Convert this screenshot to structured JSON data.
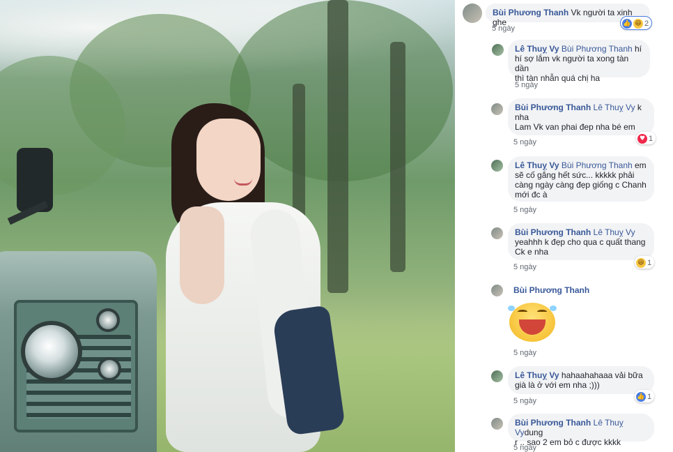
{
  "comments": [
    {
      "author": "Bùi Phương Thanh",
      "text": " Vk người ta xinh ghe",
      "time": "5 ngày",
      "reactions": {
        "icons": [
          "like-icon",
          "haha-icon"
        ],
        "count": "2"
      }
    },
    {
      "author": "Lê Thuỵ Vy",
      "mention": " Bùi Phương Thanh",
      "line1_rest": " hí",
      "line2": "hí sợ lắm vk người ta xong tàn dần",
      "line3": "thì tàn nhẫn quá chị ha",
      "time": "5 ngày"
    },
    {
      "author": "Bùi Phương Thanh",
      "mention": " Lê Thuỵ Vy",
      "line1_rest": " k",
      "line2": "nha",
      "line3": "Lam Vk van phai đep nha bé em",
      "time": "5 ngày",
      "reactions": {
        "icons": [
          "love-icon"
        ],
        "count": "1"
      }
    },
    {
      "author": "Lê Thuỵ Vy",
      "mention": " Bùi Phương Thanh",
      "line1_rest": " em",
      "line2": "sẽ cố gắng hết sức... kkkkk phải",
      "line3": "càng ngày càng đẹp giống c Chanh",
      "line4": "mới đc à",
      "time": "5 ngày"
    },
    {
      "author": "Bùi Phương Thanh",
      "mention": " Lê Thuỵ Vy",
      "line2": "yeahhh k đẹp cho qua c quất thang",
      "line3": "Ck e nha",
      "time": "5 ngày",
      "reactions": {
        "icons": [
          "haha-icon"
        ],
        "count": "1"
      }
    },
    {
      "author": "Bùi Phương Thanh",
      "sticker": "laughing-sticker",
      "time": "5 ngày"
    },
    {
      "author": "Lê Thuỵ Vy",
      "line1_rest": " hahaahahaaa vải bữa",
      "line2": "già là ở với em nha ;)))",
      "time": "5 ngày",
      "reactions": {
        "icons": [
          "like-icon"
        ],
        "count": "1"
      }
    },
    {
      "author": "Bùi Phương Thanh",
      "mention": " Lê Thuỵ Vy",
      "line1_rest": "dung",
      "line2": "r .. sao 2 em bỏ c được kkkk",
      "time": "5 ngày"
    }
  ],
  "colors": {
    "link": "#385898",
    "bubble": "#f2f3f5",
    "like": "#4a7de2",
    "love": "#f0284a",
    "haha": "#f7c641"
  }
}
